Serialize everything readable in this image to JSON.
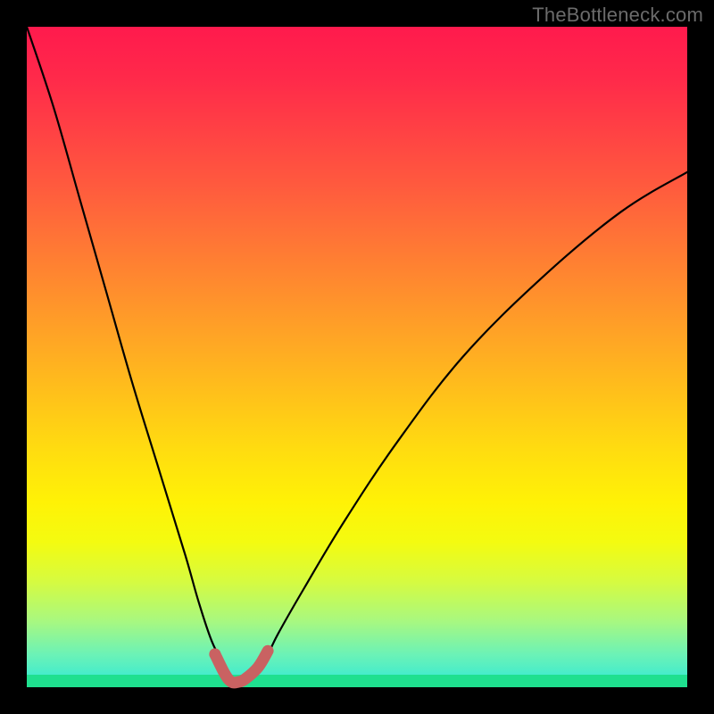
{
  "attribution": "TheBottleneck.com",
  "colors": {
    "frame": "#000000",
    "gradient_top": "#ff1a4d",
    "gradient_bottom": "#2fe9d8",
    "green_band": "#1fe08f",
    "curve_stroke": "#000000",
    "highlight_stroke": "#c96262"
  },
  "chart_data": {
    "type": "line",
    "title": "",
    "xlabel": "",
    "ylabel": "",
    "xlim": [
      0,
      100
    ],
    "ylim": [
      0,
      100
    ],
    "grid": false,
    "legend": false,
    "annotations": [
      "TheBottleneck.com"
    ],
    "series": [
      {
        "name": "bottleneck-curve",
        "x": [
          0,
          4,
          8,
          12,
          16,
          20,
          24,
          26,
          28,
          30,
          31,
          32,
          34,
          36,
          38,
          42,
          48,
          56,
          66,
          78,
          90,
          100
        ],
        "values": [
          100,
          88,
          74,
          60,
          46,
          33,
          20,
          13,
          7,
          3,
          1,
          1,
          2,
          4,
          8,
          15,
          25,
          37,
          50,
          62,
          72,
          78
        ]
      },
      {
        "name": "optimal-zone-highlight",
        "x": [
          28.5,
          30,
          31,
          32,
          33,
          35,
          36.5
        ],
        "values": [
          5.0,
          2.0,
          0.8,
          0.8,
          1.2,
          3.0,
          5.5
        ]
      }
    ],
    "points": [
      {
        "name": "highlight-dot",
        "x": 28.5,
        "y": 5.0
      }
    ]
  }
}
